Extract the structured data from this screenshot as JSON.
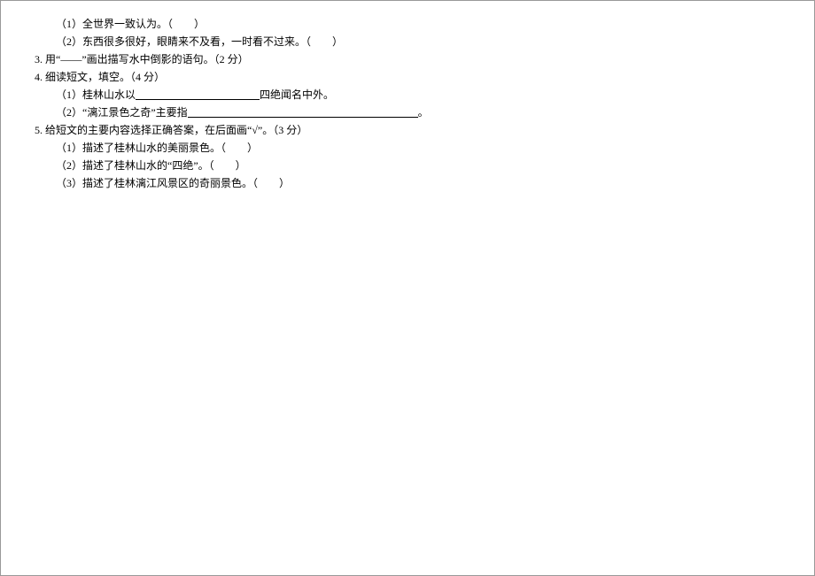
{
  "q2": {
    "sub1": "（1）全世界一致认为。（　　）",
    "sub2": "（2）东西很多很好，眼睛来不及看，一时看不过来。（　　）"
  },
  "q3": {
    "num": "3.",
    "text": "用“——”画出描写水中倒影的语句。（2 分）"
  },
  "q4": {
    "num": "4.",
    "text": "细读短文，填空。（4 分）",
    "sub1a": "（1）桂林山水以",
    "sub1b": "四绝闻名中外。",
    "sub2a": "（2）“漓江景色之奇”主要指",
    "sub2b": "。"
  },
  "q5": {
    "num": "5.",
    "text": "给短文的主要内容选择正确答案，在后面画“√”。（3 分）",
    "sub1": "（1）描述了桂林山水的美丽景色。（　　）",
    "sub2": "（2）描述了桂林山水的“四绝”。（　　）",
    "sub3": "（3）描述了桂林漓江风景区的奇丽景色。（　　）"
  }
}
